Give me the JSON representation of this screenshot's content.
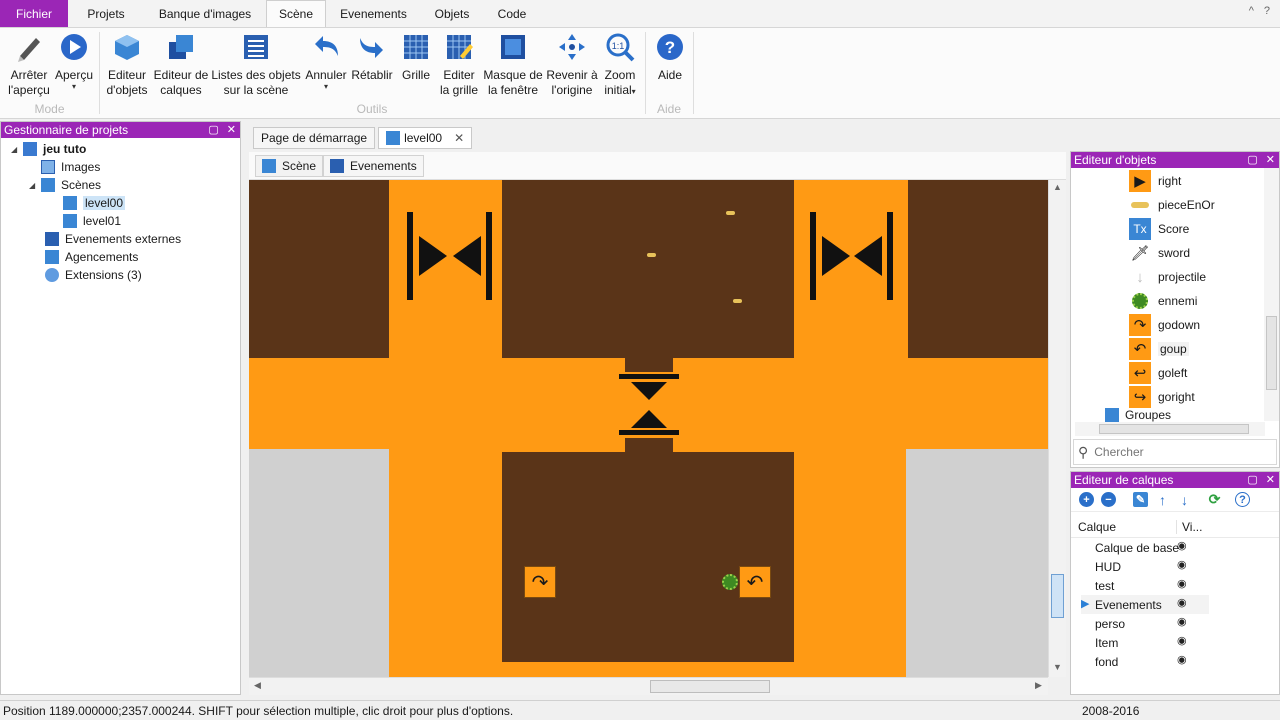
{
  "menu": {
    "tabs": [
      "Fichier",
      "Projets",
      "Banque d'images",
      "Scène",
      "Evenements",
      "Objets",
      "Code"
    ],
    "active": "Scène"
  },
  "ribbon": {
    "buttons": [
      {
        "label": "Arrêter\nl'aperçu",
        "icon": "pen-icon"
      },
      {
        "label": "Aperçu",
        "icon": "play-icon",
        "dropdown": "▾"
      },
      {
        "label": "Editeur\nd'objets",
        "icon": "cube-icon"
      },
      {
        "label": "Editeur de\ncalques",
        "icon": "layers-icon"
      },
      {
        "label": "Listes des objets\nsur la scène",
        "icon": "list-icon"
      },
      {
        "label": "Annuler",
        "icon": "undo-icon",
        "dropdown": "▾"
      },
      {
        "label": "Rétablir",
        "icon": "redo-icon"
      },
      {
        "label": "Grille",
        "icon": "grid-icon"
      },
      {
        "label": "Editer\nla grille",
        "icon": "edit-grid-icon"
      },
      {
        "label": "Masque de\nla fenêtre",
        "icon": "window-mask-icon"
      },
      {
        "label": "Revenir à\nl'origine",
        "icon": "origin-icon"
      },
      {
        "label": "Zoom\ninitial",
        "icon": "zoom-icon",
        "dropdown": "▾"
      },
      {
        "label": "Aide",
        "icon": "help-icon"
      }
    ],
    "groups": [
      "Mode",
      "Outils",
      "Aide"
    ]
  },
  "project_manager": {
    "title": "Gestionnaire de projets",
    "root": "jeu tuto",
    "items": [
      "Images",
      "Scènes",
      "level00",
      "level01",
      "Evenements externes",
      "Agencements",
      "Extensions (3)"
    ]
  },
  "doc_tabs": [
    "Page de démarrage",
    "level00"
  ],
  "scene_tabs": [
    "Scène",
    "Evenements"
  ],
  "objects_editor": {
    "title": "Editeur d'objets",
    "items": [
      "right",
      "pieceEnOr",
      "Score",
      "sword",
      "projectile",
      "ennemi",
      "godown",
      "goup",
      "goleft",
      "goright",
      "Groupes"
    ],
    "search_placeholder": "Chercher"
  },
  "layers_editor": {
    "title": "Editeur de calques",
    "columns": [
      "Calque",
      "Vi..."
    ],
    "layers": [
      "Calque de base",
      "HUD",
      "test",
      "Evenements",
      "perso",
      "Item",
      "fond"
    ],
    "selected": "Evenements"
  },
  "status": {
    "text": "Position 1189.000000;2357.000244. SHIFT pour sélection multiple, clic droit pour plus d'options.",
    "year": "2008-2016"
  },
  "colors": {
    "accent": "#9b26b6",
    "scene_orange": "#ff9a14",
    "room_brown": "#5a3418"
  }
}
